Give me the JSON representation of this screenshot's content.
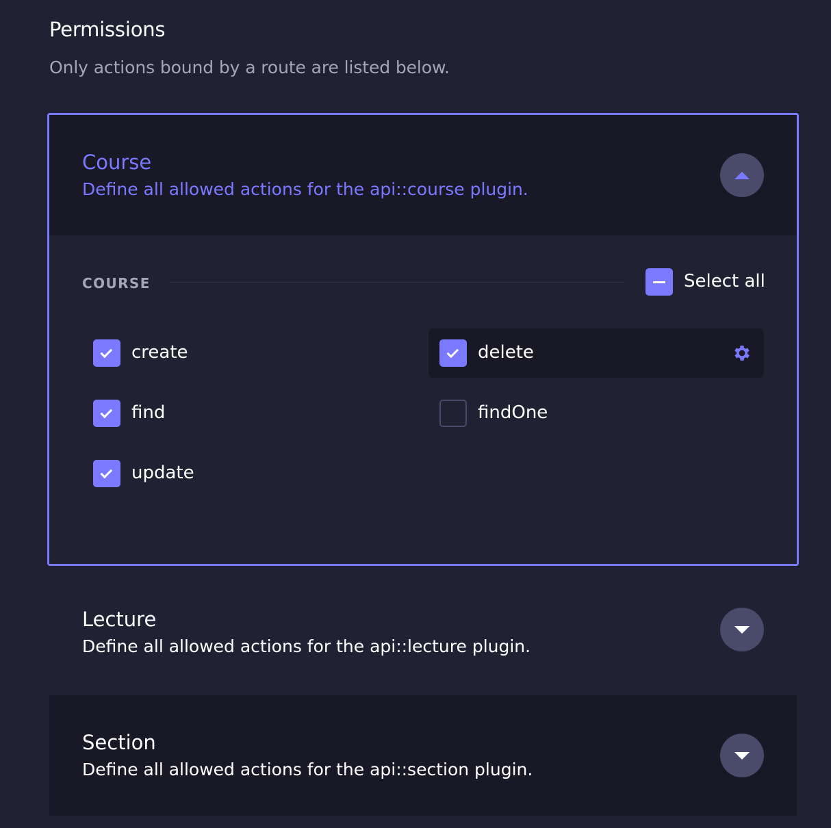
{
  "header": {
    "title": "Permissions",
    "subtitle": "Only actions bound by a route are listed below."
  },
  "accordions": [
    {
      "title": "Course",
      "description": "Define all allowed actions for the api::course plugin.",
      "expanded": true,
      "group_label": "COURSE",
      "select_all_label": "Select all",
      "select_all_state": "indeterminate",
      "permissions": [
        {
          "label": "create",
          "checked": true
        },
        {
          "label": "delete",
          "checked": true,
          "highlighted": true
        },
        {
          "label": "find",
          "checked": true
        },
        {
          "label": "findOne",
          "checked": false
        },
        {
          "label": "update",
          "checked": true
        }
      ]
    },
    {
      "title": "Lecture",
      "description": "Define all allowed actions for the api::lecture plugin.",
      "expanded": false
    },
    {
      "title": "Section",
      "description": "Define all allowed actions for the api::section plugin.",
      "expanded": false
    }
  ],
  "colors": {
    "accent": "#7b79ff",
    "background": "#212134",
    "panel": "#181826"
  },
  "icons": [
    "chevron-up-icon",
    "chevron-down-icon",
    "check-icon",
    "minus-icon",
    "gear-icon"
  ]
}
